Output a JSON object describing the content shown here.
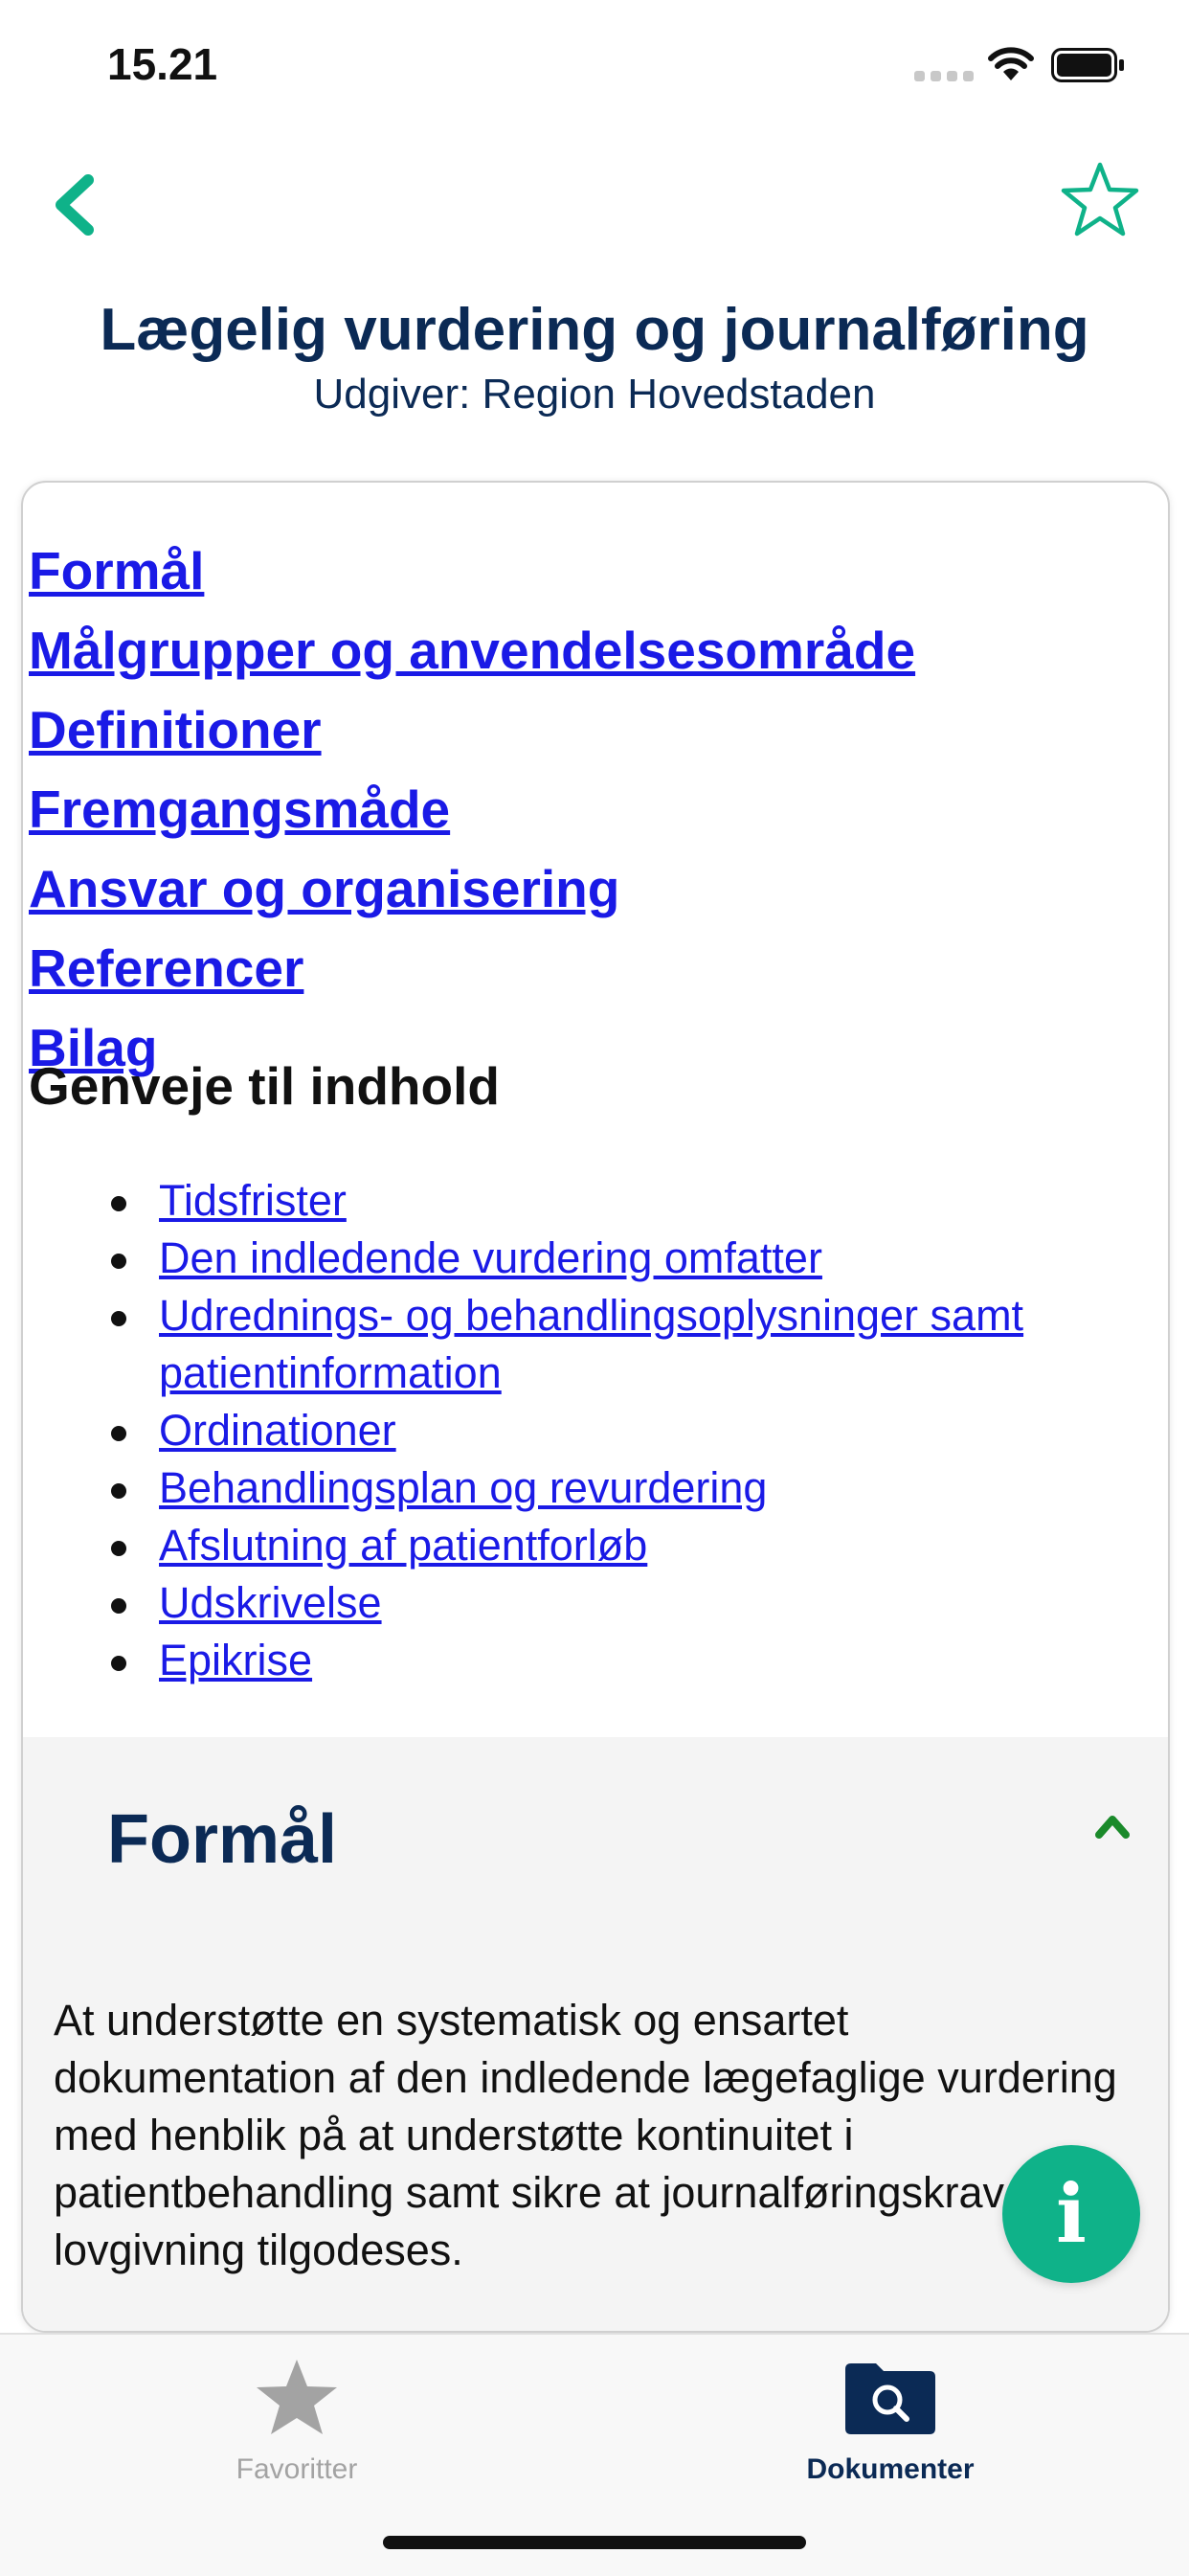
{
  "status_bar": {
    "time": "15.21"
  },
  "nav": {
    "back_icon": "chevron-left-icon",
    "favorite_icon": "star-outline-icon"
  },
  "document": {
    "title": "Lægelig vurdering og journalføring",
    "publisher": "Udgiver: Region Hovedstaden"
  },
  "toc": [
    {
      "label": "Formål"
    },
    {
      "label": "Målgrupper og anvendelsesområde"
    },
    {
      "label": "Definitioner"
    },
    {
      "label": "Fremgangsmåde"
    },
    {
      "label": "Ansvar og organisering"
    },
    {
      "label": "Referencer"
    },
    {
      "label": "Bilag"
    }
  ],
  "shortcuts": {
    "heading": "Genveje til indhold",
    "items": [
      {
        "label": "Tidsfrister"
      },
      {
        "label": "Den indledende vurdering omfatter"
      },
      {
        "label": "Udrednings- og behandlingsoplysninger samt patientinformation"
      },
      {
        "label": "Ordinationer"
      },
      {
        "label": "Behandlingsplan og revurdering"
      },
      {
        "label": "Afslutning af patientforløb"
      },
      {
        "label": "Udskrivelse"
      },
      {
        "label": "Epikrise"
      }
    ]
  },
  "section": {
    "title": "Formål",
    "expanded": true,
    "text": "At understøtte en systematisk og ensartet dokumentation af den indledende lægefaglige vurdering med henblik på at understøtte kontinuitet i patientbehandling samt sikre at journalføringskrav i lovgivning tilgodeses."
  },
  "info_button": {
    "label": "i"
  },
  "tabbar": {
    "favorites": {
      "label": "Favoritter",
      "icon": "star-icon",
      "active": false
    },
    "documents": {
      "label": "Dokumenter",
      "icon": "folder-search-icon",
      "active": true
    }
  },
  "colors": {
    "accent": "#0fb289",
    "title": "#0b2a55",
    "link": "#1a1ae6",
    "section_bg": "#f4f4f4",
    "collapse_chevron": "#1a8a2a"
  }
}
